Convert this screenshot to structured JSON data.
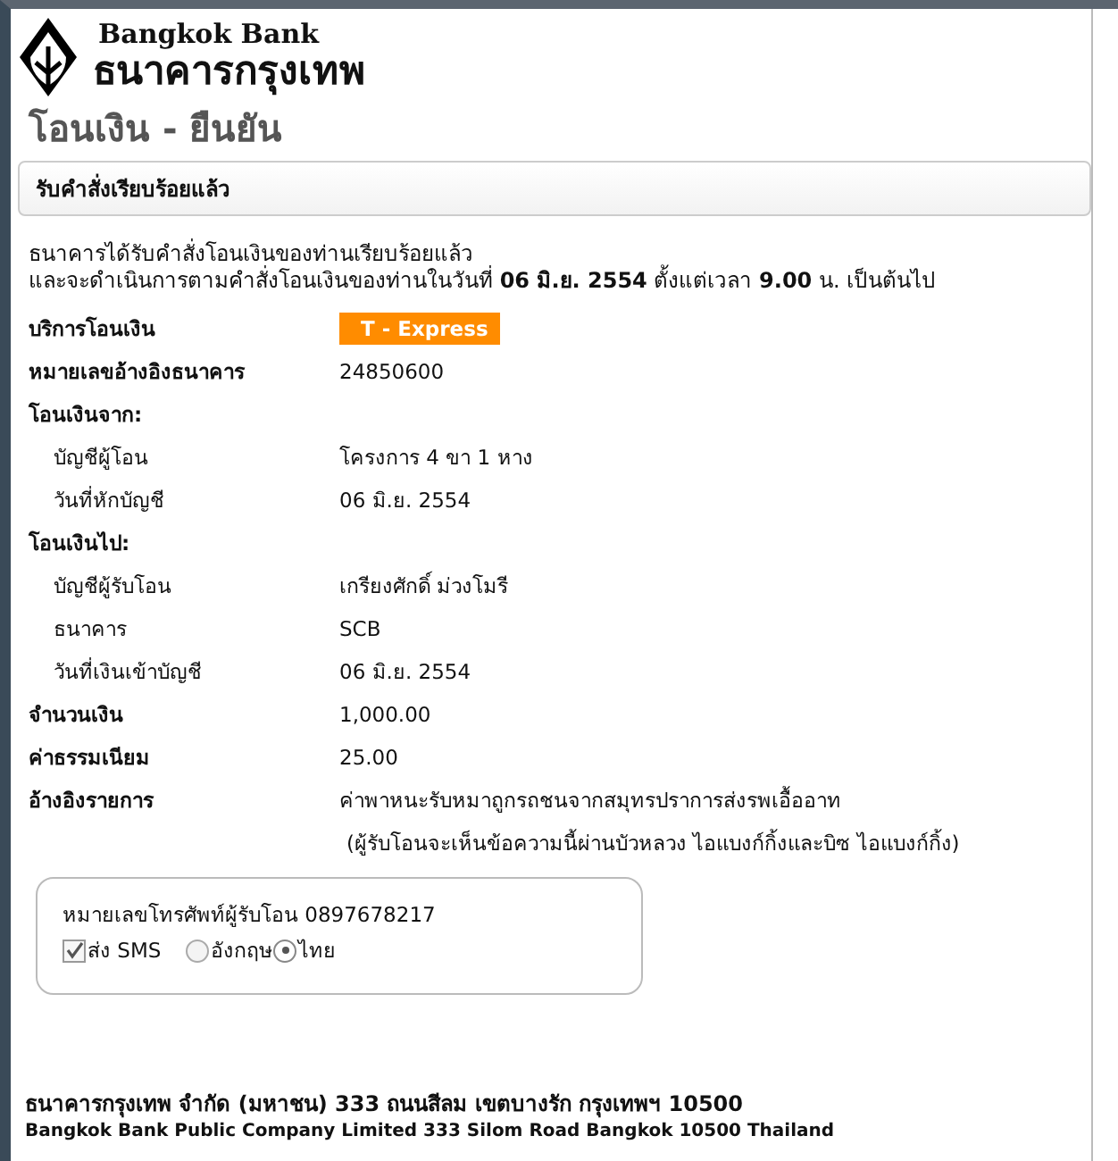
{
  "logo": {
    "name_en": "Bangkok Bank",
    "name_th": "ธนาคารกรุงเทพ"
  },
  "page_title": "โอนเงิน - ยืนยัน",
  "status_box": "รับคำสั่งเรียบร้อยแล้ว",
  "message": [
    "ธนาคารได้รับคำสั่งโอนเงินของท่านเรียบร้อยแล้ว",
    "และจะดำเนินการตามคำสั่งโอนเงินของท่านในวันที่ **06 มิ.ย. 2554** ตั้งแต่เวลา **9.00** น. เป็นต้นไป"
  ],
  "details": [
    {
      "kind": "badge",
      "label": "บริการโอนเงิน",
      "value": "T - Express"
    },
    {
      "kind": "row",
      "label": "หมายเลขอ้างอิงธนาคาร",
      "value": "24850600"
    },
    {
      "kind": "section",
      "label": "โอนเงินจาก:",
      "children": [
        {
          "label": "บัญชีผู้โอน",
          "value": "โครงการ 4 ขา 1 หาง"
        },
        {
          "label": "วันที่หักบัญชี",
          "value": "06 มิ.ย. 2554"
        }
      ]
    },
    {
      "kind": "section",
      "label": "โอนเงินไป:",
      "children": [
        {
          "label": "บัญชีผู้รับโอน",
          "value": "เกรียงศักดิ์ ม่วงโมรี"
        },
        {
          "label": "ธนาคาร",
          "value": "SCB"
        },
        {
          "label": "วันที่เงินเข้าบัญชี",
          "value": "06 มิ.ย. 2554"
        }
      ]
    },
    {
      "kind": "row",
      "label": "จำนวนเงิน",
      "value": "1,000.00"
    },
    {
      "kind": "row",
      "label": "ค่าธรรมเนียม",
      "value": "25.00"
    },
    {
      "kind": "row",
      "label": "อ้างอิงรายการ",
      "value": "ค่าพาหนะรับหมาถูกรถชนจากสมุทรปราการส่งรพเอื้ออาท",
      "note": "(ผู้รับโอนจะเห็นข้อความนี้ผ่านบัวหลวง ไอแบงก์กิ้งและบิซ ไอแบงก์กิ้ง)"
    }
  ],
  "sms": {
    "phone": "หมายเลขโทรศัพท์ผู้รับโอน 0897678217",
    "send": {
      "label": "ส่ง SMS",
      "checked": true
    },
    "languages": [
      {
        "label": "อังกฤษ",
        "selected": false
      },
      {
        "label": "ไทย",
        "selected": true
      }
    ]
  },
  "footer": [
    "ธนาคารกรุงเทพ จำกัด (มหาชน)  333 ถนนสีลม เขตบางรัก กรุงเทพฯ 10500",
    "Bangkok Bank Public Company Limited 333 Silom Road Bangkok 10500 Thailand"
  ]
}
